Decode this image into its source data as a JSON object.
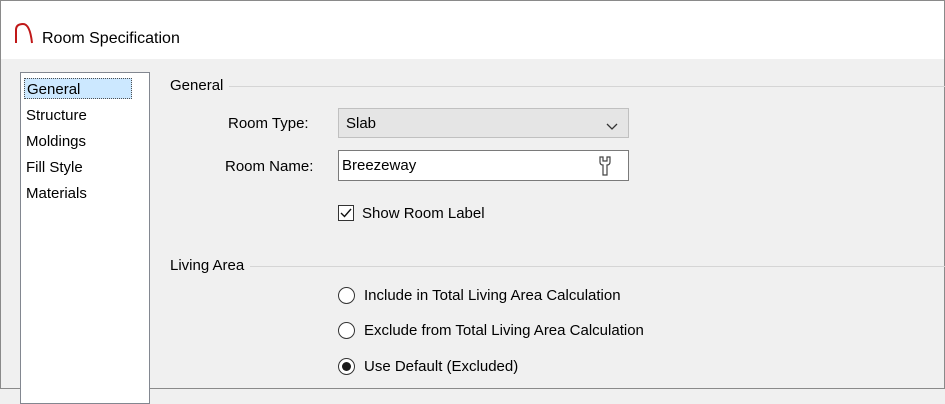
{
  "window": {
    "title": "Room Specification",
    "icon": "arch-icon"
  },
  "sidebar": {
    "items": [
      {
        "label": "General",
        "selected": true
      },
      {
        "label": "Structure"
      },
      {
        "label": "Moldings"
      },
      {
        "label": "Fill Style"
      },
      {
        "label": "Materials"
      }
    ]
  },
  "general": {
    "group_title": "General",
    "room_type_label": "Room Type:",
    "room_type_value": "Slab",
    "room_name_label": "Room Name:",
    "room_name_value": "Breezeway",
    "show_room_label": {
      "label": "Show Room Label",
      "checked": true
    }
  },
  "living_area": {
    "group_title": "Living Area",
    "options": [
      {
        "label": "Include in Total Living Area Calculation",
        "selected": false
      },
      {
        "label": "Exclude from Total Living Area Calculation",
        "selected": false
      },
      {
        "label": "Use Default (Excluded)",
        "selected": true
      }
    ]
  }
}
